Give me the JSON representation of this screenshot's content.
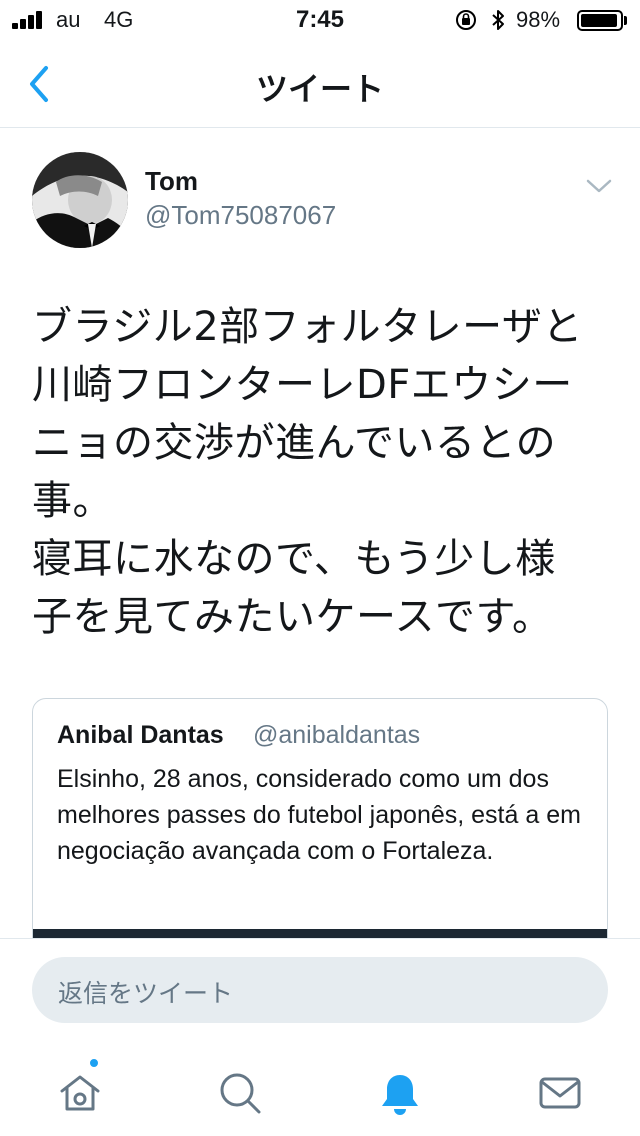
{
  "status_bar": {
    "carrier": "au",
    "network": "4G",
    "time": "7:45",
    "battery_percent": "98%",
    "battery_level": 0.98,
    "icons": [
      "signal-icon",
      "rotation-lock-icon",
      "bluetooth-icon",
      "battery-icon"
    ]
  },
  "nav": {
    "title": "ツイート",
    "back_icon": "chevron-left-icon"
  },
  "tweet": {
    "author_name": "Tom",
    "author_handle": "@Tom75087067",
    "text": "ブラジル2部フォルタレーザと\n川崎フロンターレDFエウシー\nニョの交渉が進んでいるとの\n事。\n寝耳に水なので、もう少し様\n子を見てみたいケースです。",
    "menu_icon": "chevron-down-icon"
  },
  "quote": {
    "author_name": "Anibal Dantas",
    "author_handle": "@anibaldantas",
    "text": "Elsinho, 28 anos, considerado como um dos melhores passes do futebol japonês, está a em negociação avançada com o Fortaleza."
  },
  "reply": {
    "placeholder": "返信をツイート"
  },
  "tab_bar": {
    "tabs": [
      "home-icon",
      "search-icon",
      "notifications-icon",
      "messages-icon"
    ],
    "active": "notifications-icon",
    "accent_color": "#1da1f2",
    "inactive_color": "#657786"
  }
}
